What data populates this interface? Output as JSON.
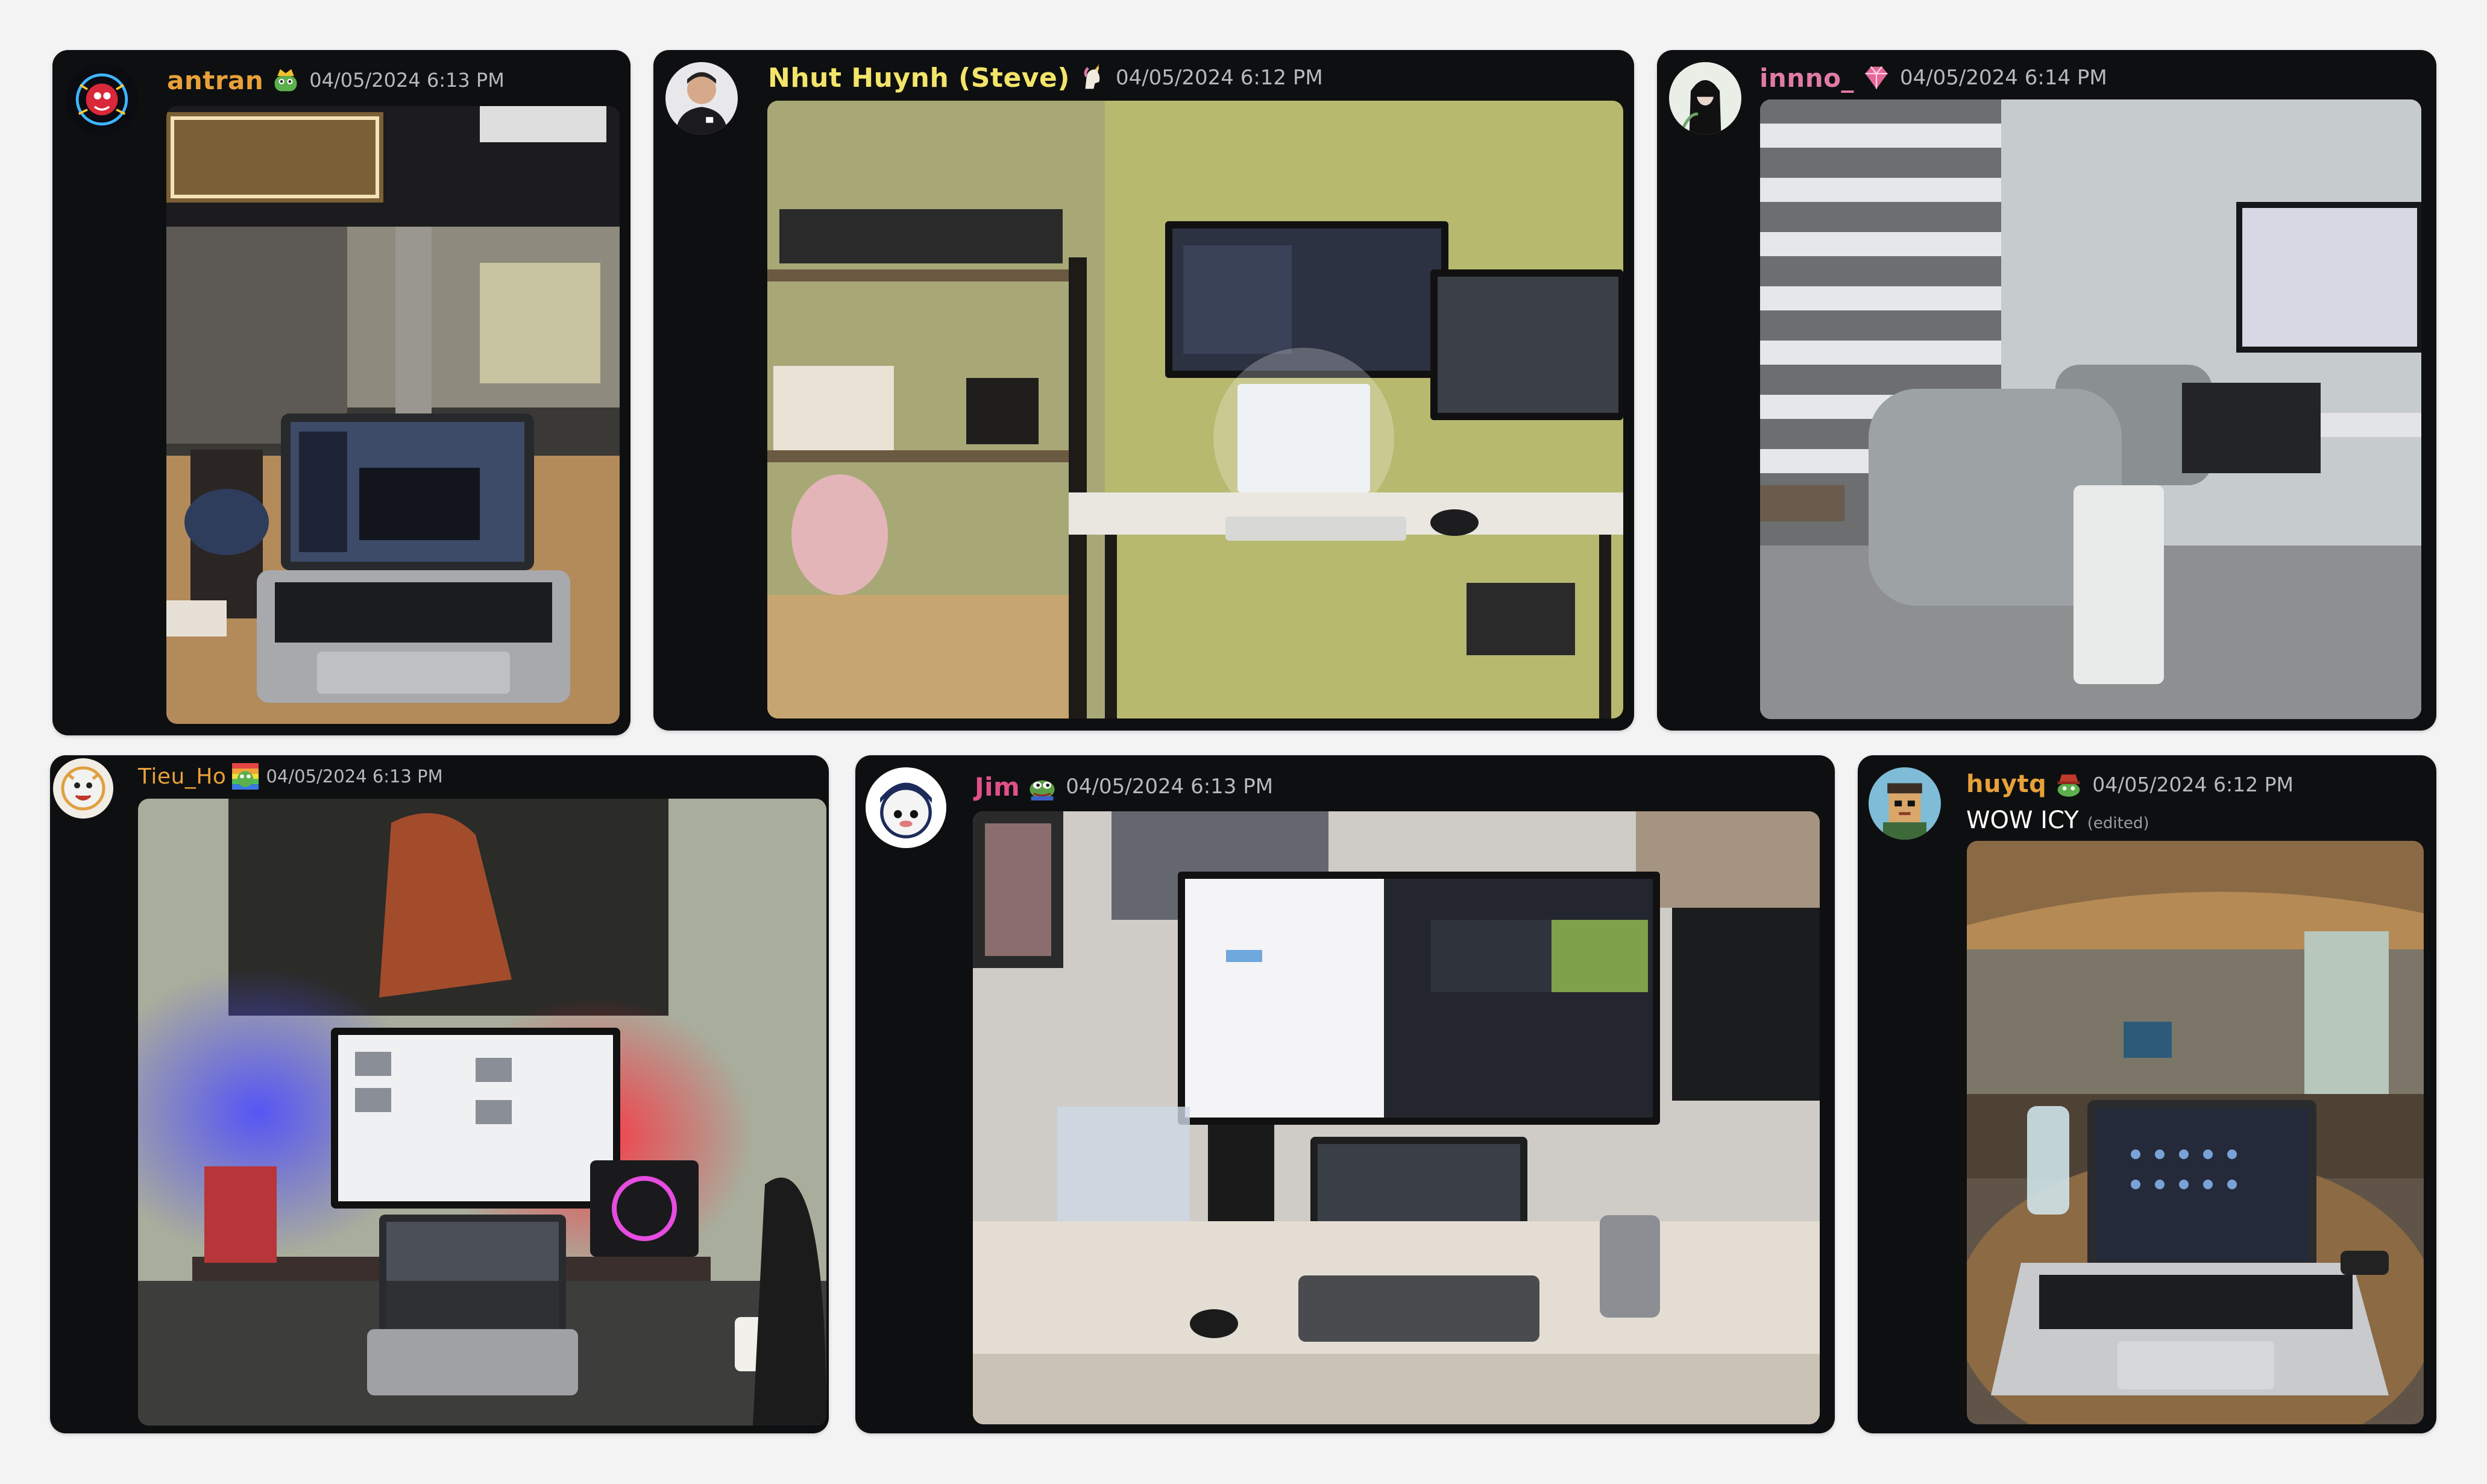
{
  "posts": [
    {
      "username": "antran",
      "username_color": "#e8a13a",
      "badge_icon": "frog-crown-icon",
      "timestamp": "04/05/2024 6:13 PM",
      "photo": "laptop-cafe-photo"
    },
    {
      "username": "Nhut Huynh (Steve)",
      "username_color": "#f3e46a",
      "badge_icon": "unicorn-icon",
      "timestamp": "04/05/2024 6:12 PM",
      "photo": "green-wall-desk-setup-photo"
    },
    {
      "username": "innno_",
      "username_color": "#e07ba8",
      "badge_icon": "pink-gem-icon",
      "timestamp": "04/05/2024 6:14 PM",
      "photo": "minimal-room-desk-photo"
    },
    {
      "username": "Tieu_Ho",
      "username_color": "#e8a13a",
      "badge_icon": "rainbow-frog-icon",
      "timestamp": "04/05/2024 6:13 PM",
      "photo": "rgb-desk-setup-photo"
    },
    {
      "username": "Jim",
      "username_color": "#e0508a",
      "badge_icon": "pepe-frog-icon",
      "timestamp": "04/05/2024 6:13 PM",
      "photo": "dual-monitor-desk-photo"
    },
    {
      "username": "huytq",
      "username_color": "#e8a13a",
      "badge_icon": "frog-hat-icon",
      "timestamp": "04/05/2024 6:12 PM",
      "message": "WOW ICY",
      "edited_label": "(edited)",
      "photo": "lounge-laptop-photo"
    }
  ]
}
